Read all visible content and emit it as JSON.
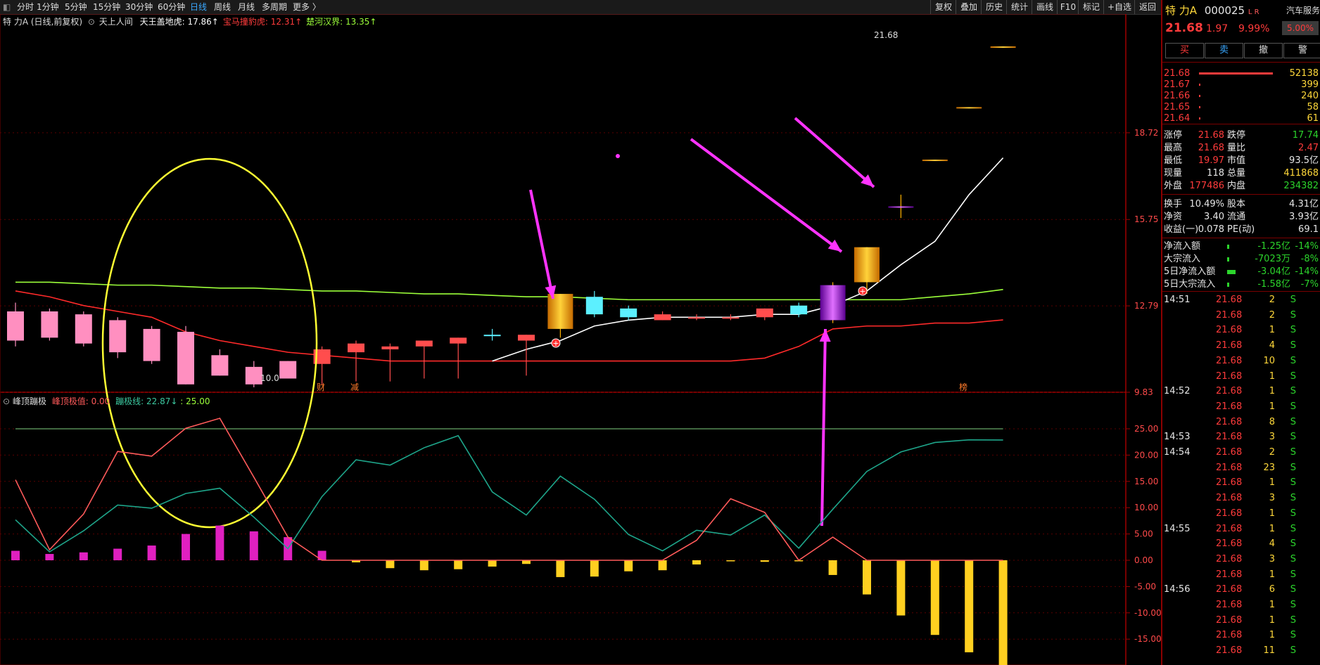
{
  "toolbar": {
    "periods": [
      "分时",
      "1分钟",
      "5分钟",
      "15分钟",
      "30分钟",
      "60分钟",
      "日线",
      "周线",
      "月线",
      "多周期",
      "更多 〉"
    ],
    "active_period": "日线",
    "right_buttons": [
      "复权",
      "叠加",
      "历史",
      "统计",
      "画线",
      "F10",
      "标记",
      "+自选",
      "返回"
    ]
  },
  "chart_header": {
    "title": "特 力A (日线,前复权)",
    "indicator_name": "天上人间",
    "items": [
      {
        "label": "天王盖地虎: 17.86↑",
        "color": "#ffffff"
      },
      {
        "label": "宝马撞豹虎: 12.31↑",
        "color": "#ff3b3b"
      },
      {
        "label": "楚河汉界: 13.35↑",
        "color": "#9cff3a"
      }
    ]
  },
  "price_axis": [
    "18.72",
    "15.75",
    "12.79",
    "9.83"
  ],
  "high_label": "21.68",
  "low_label": "10.0",
  "bottom_marks": [
    "财",
    "减",
    "榜"
  ],
  "sub_header": {
    "name": "峰顶蹦极",
    "v1": "峰顶极值: 0.00",
    "v2": "蹦极线: 22.87↓",
    "v3": ": 25.00"
  },
  "sub_axis": [
    "25.00",
    "20.00",
    "15.00",
    "10.00",
    "5.00",
    "0.00",
    "-5.00",
    "-10.00",
    "-15.00"
  ],
  "chart_data": {
    "type": "candlestick",
    "title": "特 力A (日线,前复权)",
    "ylim": [
      9.83,
      21.68
    ],
    "candles": [
      {
        "o": 12.6,
        "c": 11.6,
        "h": 12.9,
        "l": 11.4,
        "color": "pink"
      },
      {
        "o": 12.6,
        "c": 11.7,
        "h": 12.7,
        "l": 11.6,
        "color": "pink"
      },
      {
        "o": 12.5,
        "c": 11.5,
        "h": 12.6,
        "l": 11.4,
        "color": "pink"
      },
      {
        "o": 12.3,
        "c": 11.2,
        "h": 12.4,
        "l": 11.0,
        "color": "pink"
      },
      {
        "o": 12.0,
        "c": 10.9,
        "h": 12.1,
        "l": 10.8,
        "color": "pink"
      },
      {
        "o": 11.9,
        "c": 10.1,
        "h": 12.1,
        "l": 10.1,
        "color": "pink"
      },
      {
        "o": 11.1,
        "c": 10.4,
        "h": 11.3,
        "l": 10.4,
        "color": "pink"
      },
      {
        "o": 10.7,
        "c": 10.1,
        "h": 10.9,
        "l": 10.0,
        "color": "pink"
      },
      {
        "o": 10.9,
        "c": 10.3,
        "h": 10.9,
        "l": 10.3,
        "color": "pink"
      },
      {
        "o": 10.8,
        "c": 11.3,
        "h": 11.4,
        "l": 10.1,
        "color": "red"
      },
      {
        "o": 11.2,
        "c": 11.5,
        "h": 11.6,
        "l": 10.2,
        "color": "red"
      },
      {
        "o": 11.3,
        "c": 11.4,
        "h": 11.5,
        "l": 10.2,
        "color": "red"
      },
      {
        "o": 11.4,
        "c": 11.6,
        "h": 11.6,
        "l": 10.3,
        "color": "red"
      },
      {
        "o": 11.5,
        "c": 11.7,
        "h": 11.7,
        "l": 10.3,
        "color": "red"
      },
      {
        "o": 11.8,
        "c": 11.8,
        "h": 12.0,
        "l": 11.6,
        "color": "cyan"
      },
      {
        "o": 11.6,
        "c": 11.8,
        "h": 11.8,
        "l": 10.4,
        "color": "red"
      },
      {
        "o": 12.0,
        "c": 13.2,
        "h": 13.2,
        "l": 11.7,
        "color": "gold"
      },
      {
        "o": 13.1,
        "c": 12.5,
        "h": 13.3,
        "l": 12.4,
        "color": "cyan"
      },
      {
        "o": 12.7,
        "c": 12.4,
        "h": 12.8,
        "l": 12.3,
        "color": "cyan"
      },
      {
        "o": 12.3,
        "c": 12.5,
        "h": 12.6,
        "l": 12.3,
        "color": "red"
      },
      {
        "o": 12.4,
        "c": 12.4,
        "h": 12.5,
        "l": 12.3,
        "color": "red"
      },
      {
        "o": 12.4,
        "c": 12.4,
        "h": 12.5,
        "l": 12.3,
        "color": "red"
      },
      {
        "o": 12.4,
        "c": 12.7,
        "h": 12.7,
        "l": 12.3,
        "color": "red"
      },
      {
        "o": 12.8,
        "c": 12.5,
        "h": 12.9,
        "l": 12.4,
        "color": "cyan"
      },
      {
        "o": 12.3,
        "c": 13.5,
        "h": 13.6,
        "l": 12.2,
        "color": "purple"
      },
      {
        "o": 13.6,
        "c": 14.8,
        "h": 14.8,
        "l": 13.2,
        "color": "gold"
      },
      {
        "o": 16.2,
        "c": 16.2,
        "h": 16.6,
        "l": 15.8,
        "color": "purple"
      },
      {
        "o": 17.8,
        "c": 17.8,
        "h": 17.8,
        "l": 17.8,
        "color": "gold"
      },
      {
        "o": 19.6,
        "c": 19.6,
        "h": 19.6,
        "l": 19.6,
        "color": "gold"
      },
      {
        "o": 21.68,
        "c": 21.68,
        "h": 21.68,
        "l": 21.68,
        "color": "gold"
      }
    ],
    "ma_white": [
      null,
      null,
      null,
      null,
      null,
      null,
      null,
      null,
      null,
      null,
      null,
      null,
      null,
      null,
      10.9,
      11.3,
      11.6,
      12.1,
      12.3,
      12.4,
      12.4,
      12.4,
      12.5,
      12.5,
      12.8,
      13.3,
      14.2,
      15.0,
      16.6,
      17.86
    ],
    "ma_red": [
      13.3,
      13.1,
      12.8,
      12.6,
      12.4,
      11.9,
      11.6,
      11.4,
      11.2,
      11.1,
      11.0,
      10.9,
      10.9,
      10.9,
      10.9,
      10.9,
      10.9,
      10.9,
      10.9,
      10.9,
      10.9,
      10.9,
      11.0,
      11.4,
      12.0,
      12.1,
      12.1,
      12.2,
      12.2,
      12.31
    ],
    "ma_green": [
      13.6,
      13.6,
      13.55,
      13.5,
      13.5,
      13.45,
      13.4,
      13.4,
      13.35,
      13.3,
      13.3,
      13.25,
      13.2,
      13.2,
      13.15,
      13.1,
      13.1,
      13.05,
      13.0,
      13.0,
      13.0,
      13.0,
      13.0,
      13.0,
      13.0,
      13.0,
      13.0,
      13.1,
      13.2,
      13.35
    ],
    "sub": {
      "ylim": [
        -20,
        30
      ],
      "bars": [
        1.8,
        1.2,
        1.5,
        2.2,
        2.8,
        5.0,
        6.6,
        5.5,
        4.4,
        1.8,
        -0.4,
        -1.5,
        -1.9,
        -1.7,
        -1.2,
        -0.7,
        -3.2,
        -3.1,
        -2.1,
        -1.9,
        -0.8,
        -0.2,
        -0.3,
        -0.2,
        -2.8,
        -6.5,
        -10.5,
        -14.2,
        -17.5,
        -20.5
      ],
      "peak": [
        15.3,
        2.0,
        8.8,
        20.7,
        19.8,
        25.1,
        27.0,
        15.8,
        4.4,
        0.0,
        0.0,
        0.0,
        0.0,
        0.0,
        0.0,
        0.0,
        0.0,
        0.0,
        0.0,
        0.0,
        3.8,
        11.7,
        9.1,
        0.0,
        4.4,
        0.0,
        0.0,
        0.0,
        0.0,
        0.0
      ],
      "line": [
        7.7,
        1.6,
        5.6,
        10.5,
        9.9,
        12.7,
        13.7,
        8.2,
        2.2,
        12.1,
        19.1,
        18.1,
        21.4,
        23.7,
        13.0,
        8.6,
        16.0,
        11.6,
        4.9,
        1.8,
        5.7,
        4.8,
        8.6,
        2.3,
        9.7,
        16.9,
        20.6,
        22.4,
        22.9,
        22.87
      ],
      "hline": 25
    }
  },
  "stock": {
    "name": "特 力A",
    "code": "000025",
    "flags": "L R",
    "industry": "汽车服务",
    "price": "21.68",
    "change": "1.97",
    "pct": "9.99%",
    "ind_pct": "5.00%"
  },
  "trade_buttons": [
    "买",
    "卖",
    "撤",
    "警"
  ],
  "order_book": [
    {
      "price": "21.68",
      "vol": "52138",
      "bar": 0.95
    },
    {
      "price": "21.67",
      "vol": "399",
      "bar": 0.01
    },
    {
      "price": "21.66",
      "vol": "240",
      "bar": 0.01
    },
    {
      "price": "21.65",
      "vol": "58",
      "bar": 0.005
    },
    {
      "price": "21.64",
      "vol": "61",
      "bar": 0.005
    }
  ],
  "quote": [
    {
      "l": "涨停",
      "v": "21.68",
      "vc": "red",
      "l2": "跌停",
      "v2": "17.74",
      "v2c": "green"
    },
    {
      "l": "最高",
      "v": "21.68",
      "vc": "red",
      "l2": "量比",
      "v2": "2.47",
      "v2c": "red"
    },
    {
      "l": "最低",
      "v": "19.97",
      "vc": "red",
      "l2": "市值",
      "v2": "93.5亿",
      "v2c": "white"
    },
    {
      "l": "现量",
      "v": "118",
      "vc": "white",
      "l2": "总量",
      "v2": "411868",
      "v2c": "yellow"
    },
    {
      "l": "外盘",
      "v": "177486",
      "vc": "red",
      "l2": "内盘",
      "v2": "234382",
      "v2c": "green"
    }
  ],
  "fundamentals": [
    {
      "l": "换手",
      "v": "10.49%",
      "l2": "股本",
      "v2": "4.31亿"
    },
    {
      "l": "净资",
      "v": "3.40",
      "l2": "流通",
      "v2": "3.93亿"
    },
    {
      "l": "收益(一)",
      "v": "0.078",
      "l2": "PE(动)",
      "v2": "69.1"
    }
  ],
  "flows": [
    {
      "l": "净流入额",
      "v": "-1.25亿",
      "p": "-14%"
    },
    {
      "l": "大宗流入",
      "v": "-7023万",
      "p": "-8%"
    },
    {
      "l": "5日净流入额",
      "v": "-3.04亿",
      "p": "-14%"
    },
    {
      "l": "5日大宗流入",
      "v": "-1.58亿",
      "p": "-7%"
    }
  ],
  "ticks": [
    {
      "t": "14:51",
      "p": "21.68",
      "v": "2",
      "s": "S"
    },
    {
      "t": "",
      "p": "21.68",
      "v": "2",
      "s": "S"
    },
    {
      "t": "",
      "p": "21.68",
      "v": "1",
      "s": "S"
    },
    {
      "t": "",
      "p": "21.68",
      "v": "4",
      "s": "S"
    },
    {
      "t": "",
      "p": "21.68",
      "v": "10",
      "s": "S"
    },
    {
      "t": "",
      "p": "21.68",
      "v": "1",
      "s": "S"
    },
    {
      "t": "14:52",
      "p": "21.68",
      "v": "1",
      "s": "S"
    },
    {
      "t": "",
      "p": "21.68",
      "v": "1",
      "s": "S"
    },
    {
      "t": "",
      "p": "21.68",
      "v": "8",
      "s": "S"
    },
    {
      "t": "14:53",
      "p": "21.68",
      "v": "3",
      "s": "S"
    },
    {
      "t": "14:54",
      "p": "21.68",
      "v": "2",
      "s": "S"
    },
    {
      "t": "",
      "p": "21.68",
      "v": "23",
      "s": "S"
    },
    {
      "t": "",
      "p": "21.68",
      "v": "1",
      "s": "S"
    },
    {
      "t": "",
      "p": "21.68",
      "v": "3",
      "s": "S"
    },
    {
      "t": "",
      "p": "21.68",
      "v": "1",
      "s": "S"
    },
    {
      "t": "14:55",
      "p": "21.68",
      "v": "1",
      "s": "S"
    },
    {
      "t": "",
      "p": "21.68",
      "v": "4",
      "s": "S"
    },
    {
      "t": "",
      "p": "21.68",
      "v": "3",
      "s": "S"
    },
    {
      "t": "",
      "p": "21.68",
      "v": "1",
      "s": "S"
    },
    {
      "t": "14:56",
      "p": "21.68",
      "v": "6",
      "s": "S"
    },
    {
      "t": "",
      "p": "21.68",
      "v": "1",
      "s": "S"
    },
    {
      "t": "",
      "p": "21.68",
      "v": "1",
      "s": "S"
    },
    {
      "t": "",
      "p": "21.68",
      "v": "1",
      "s": "S"
    },
    {
      "t": "",
      "p": "21.68",
      "v": "11",
      "s": "S"
    }
  ]
}
